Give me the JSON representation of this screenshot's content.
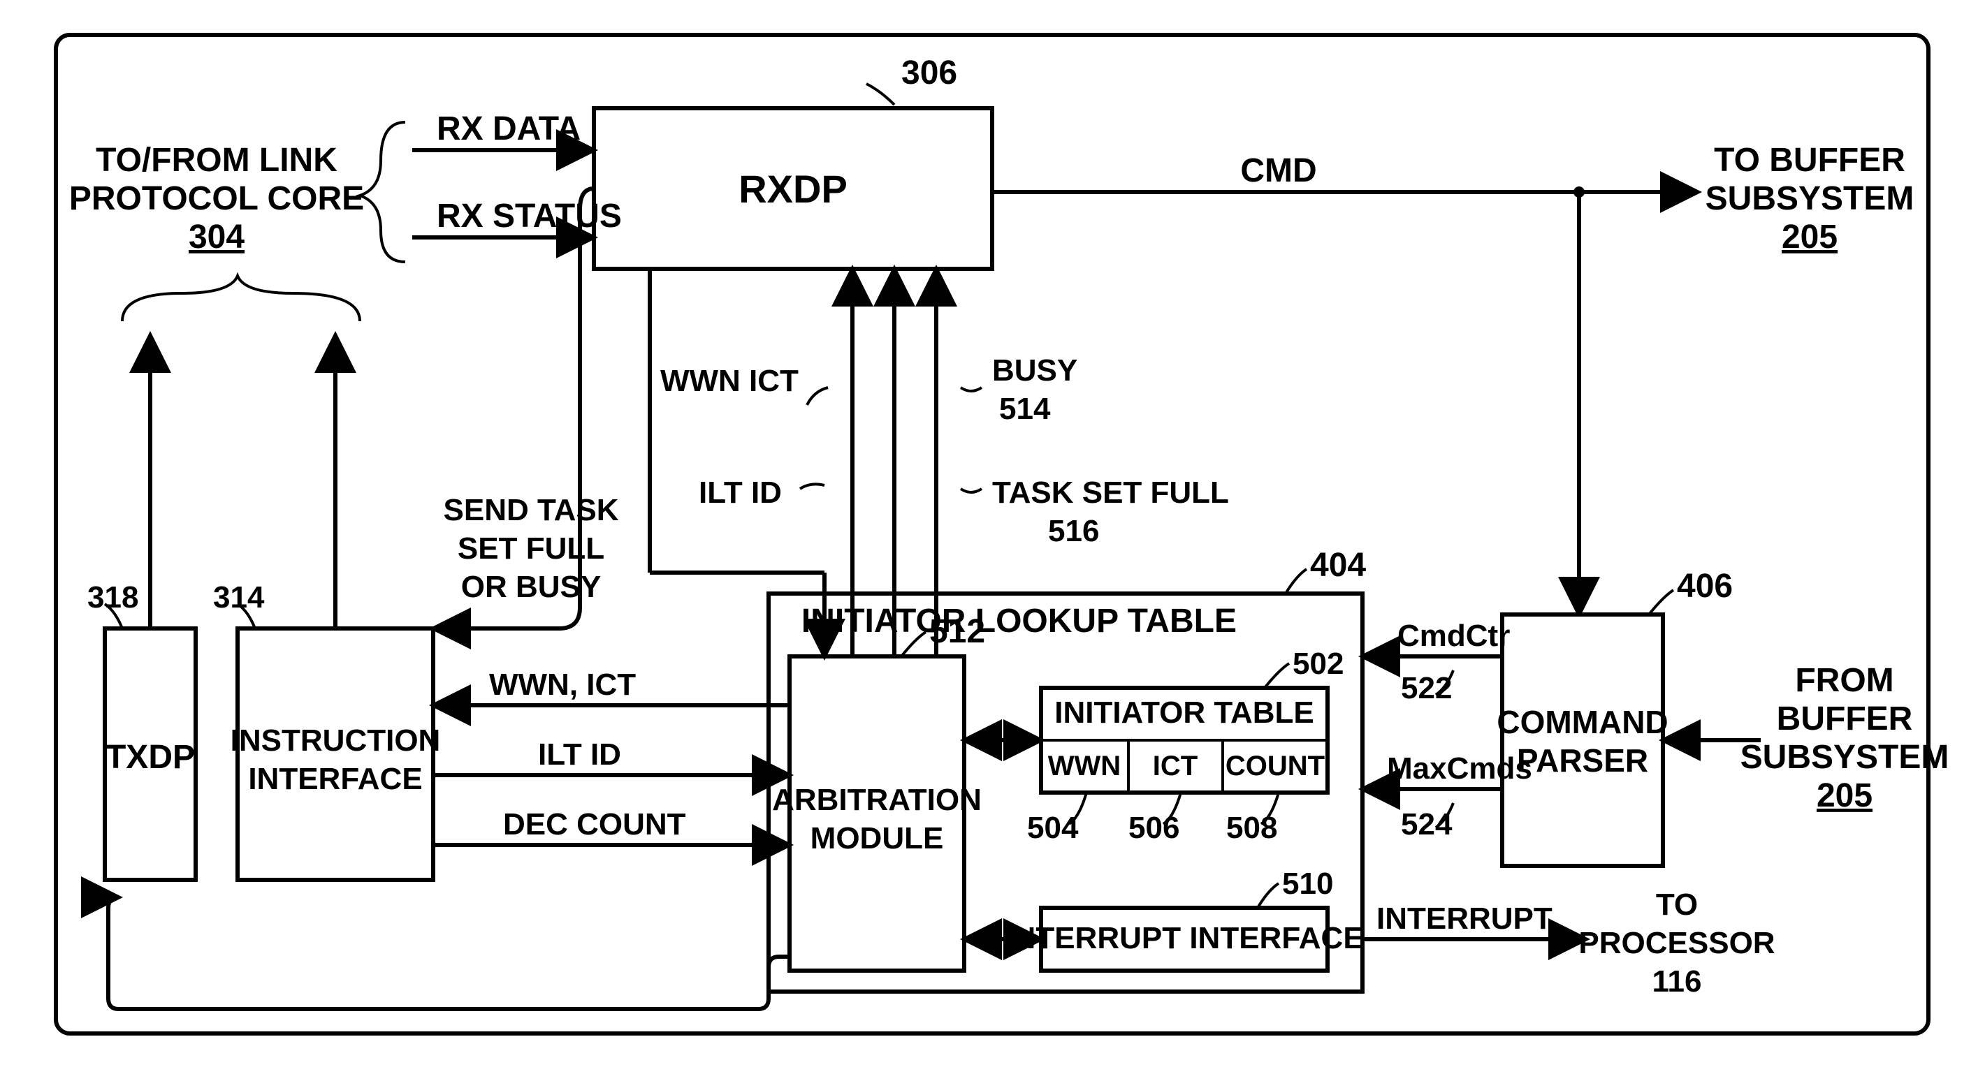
{
  "ext": {
    "linkCore1": "TO/FROM LINK",
    "linkCore2": "PROTOCOL CORE",
    "linkCoreRef": "304",
    "toBuffer1": "TO BUFFER",
    "toBuffer2": "SUBSYSTEM",
    "toBufferRef": "205",
    "fromBuffer1": "FROM",
    "fromBuffer2": "BUFFER",
    "fromBuffer3": "SUBSYSTEM",
    "fromBufferRef": "205",
    "toProc1": "TO",
    "toProc2": "PROCESSOR",
    "toProcRef": "116"
  },
  "blocks": {
    "rxdp": "RXDP",
    "rxdpRef": "306",
    "txdp": "TXDP",
    "txdpRef": "318",
    "instrIf1": "INSTRUCTION",
    "instrIf2": "INTERFACE",
    "instrIfRef": "314",
    "ilt": "INITIATOR LOOKUP TABLE",
    "iltRef": "404",
    "arb1": "ARBITRATION",
    "arb2": "MODULE",
    "arbRef": "512",
    "initTable": "INITIATOR TABLE",
    "initTableRef": "502",
    "col1": "WWN",
    "col1Ref": "504",
    "col2": "ICT",
    "col2Ref": "506",
    "col3": "COUNT",
    "col3Ref": "508",
    "intrIf": "INTERRUPT INTERFACE",
    "intrIfRef": "510",
    "cmdParser1": "COMMAND",
    "cmdParser2": "PARSER",
    "cmdParserRef": "406"
  },
  "signals": {
    "rxData": "RX DATA",
    "rxStatus": "RX STATUS",
    "cmd": "CMD",
    "wwnIct": "WWN ICT",
    "iltId": "ILT ID",
    "busy": "BUSY",
    "busyRef": "514",
    "taskSetFull": "TASK SET FULL",
    "taskSetFullRef": "516",
    "sendTask1": "SEND TASK",
    "sendTask2": "SET FULL",
    "sendTask3": "OR BUSY",
    "wwnIct2": "WWN, ICT",
    "iltId2": "ILT ID",
    "decCount": "DEC COUNT",
    "cmdCtr": "CmdCtr",
    "cmdCtrRef": "522",
    "maxCmds": "MaxCmds",
    "maxCmdsRef": "524",
    "interrupt": "INTERRUPT"
  }
}
